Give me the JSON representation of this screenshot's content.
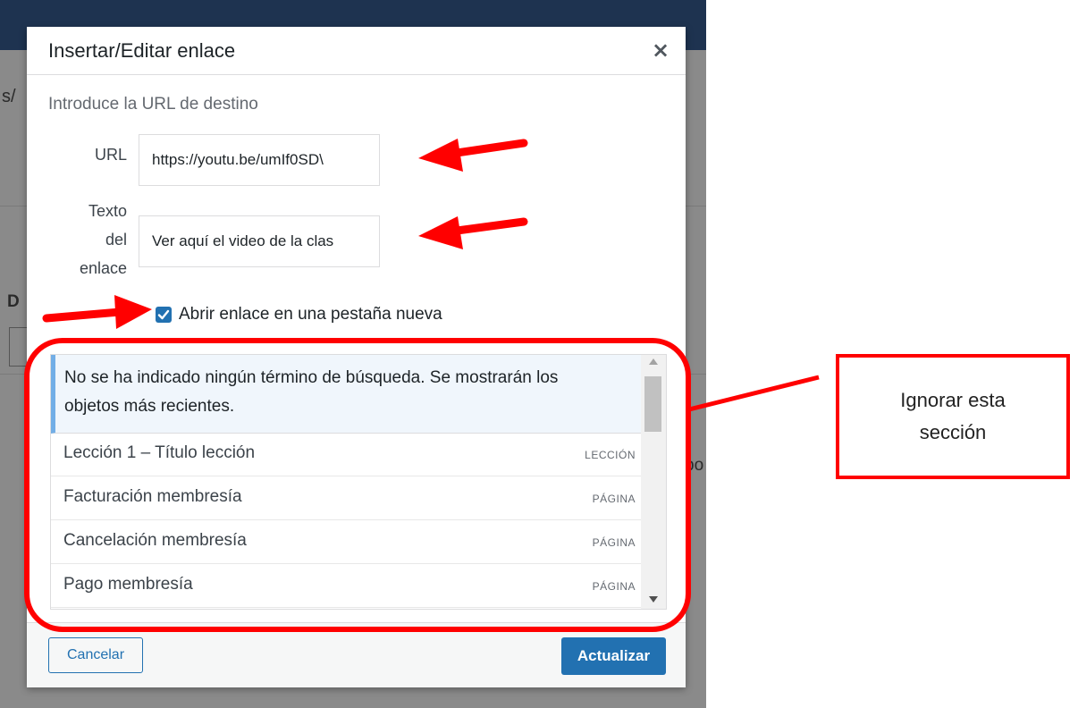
{
  "background_page": {
    "breadcrumb_fragment": "s/",
    "heading_fragment": "D",
    "side_fragment": "po"
  },
  "dialog": {
    "title": "Insertar/Editar enlace",
    "close_symbol": "×",
    "intro": "Introduce la URL de destino",
    "url_label": "URL",
    "url_value": "https://youtu.be/umIf0SD\\",
    "link_text_label": "Texto del enlace",
    "link_text_value": "Ver aquí el video de la clas",
    "new_tab_label": "Abrir enlace en una pestaña nueva",
    "new_tab_checked": true,
    "search_notice": "No se ha indicado ningún término de búsqueda. Se mostrarán los objetos más recientes.",
    "results": [
      {
        "title": "Lección 1 – Título lección",
        "type": "LECCIÓN"
      },
      {
        "title": "Facturación membresía",
        "type": "PÁGINA"
      },
      {
        "title": "Cancelación membresía",
        "type": "PÁGINA"
      },
      {
        "title": "Pago membresía",
        "type": "PÁGINA"
      }
    ],
    "cancel_label": "Cancelar",
    "update_label": "Actualizar"
  },
  "annotation": {
    "note": "Ignorar esta sección",
    "color": "#ff0000"
  },
  "colors": {
    "primary": "#2271b1",
    "notice_border": "#72aee6",
    "topbar": "#1e3350"
  },
  "icons": [
    "close-icon",
    "checkbox-check-icon",
    "scroll-up-arrow-icon",
    "scroll-down-arrow-icon",
    "red-arrow-icon"
  ]
}
